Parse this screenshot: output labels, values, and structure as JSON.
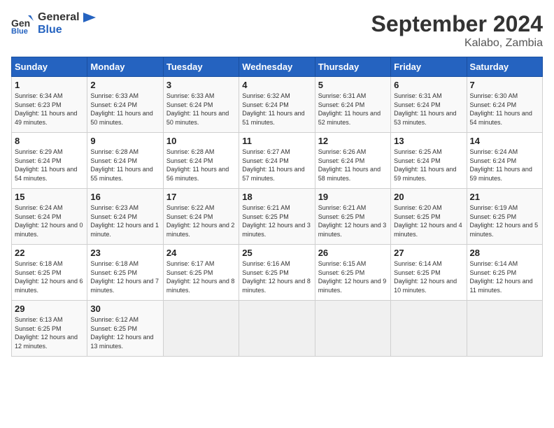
{
  "logo": {
    "line1": "General",
    "line2": "Blue"
  },
  "title": "September 2024",
  "subtitle": "Kalabo, Zambia",
  "days_header": [
    "Sunday",
    "Monday",
    "Tuesday",
    "Wednesday",
    "Thursday",
    "Friday",
    "Saturday"
  ],
  "weeks": [
    [
      {
        "day": "1",
        "sunrise": "Sunrise: 6:34 AM",
        "sunset": "Sunset: 6:23 PM",
        "daylight": "Daylight: 11 hours and 49 minutes."
      },
      {
        "day": "2",
        "sunrise": "Sunrise: 6:33 AM",
        "sunset": "Sunset: 6:24 PM",
        "daylight": "Daylight: 11 hours and 50 minutes."
      },
      {
        "day": "3",
        "sunrise": "Sunrise: 6:33 AM",
        "sunset": "Sunset: 6:24 PM",
        "daylight": "Daylight: 11 hours and 50 minutes."
      },
      {
        "day": "4",
        "sunrise": "Sunrise: 6:32 AM",
        "sunset": "Sunset: 6:24 PM",
        "daylight": "Daylight: 11 hours and 51 minutes."
      },
      {
        "day": "5",
        "sunrise": "Sunrise: 6:31 AM",
        "sunset": "Sunset: 6:24 PM",
        "daylight": "Daylight: 11 hours and 52 minutes."
      },
      {
        "day": "6",
        "sunrise": "Sunrise: 6:31 AM",
        "sunset": "Sunset: 6:24 PM",
        "daylight": "Daylight: 11 hours and 53 minutes."
      },
      {
        "day": "7",
        "sunrise": "Sunrise: 6:30 AM",
        "sunset": "Sunset: 6:24 PM",
        "daylight": "Daylight: 11 hours and 54 minutes."
      }
    ],
    [
      {
        "day": "8",
        "sunrise": "Sunrise: 6:29 AM",
        "sunset": "Sunset: 6:24 PM",
        "daylight": "Daylight: 11 hours and 54 minutes."
      },
      {
        "day": "9",
        "sunrise": "Sunrise: 6:28 AM",
        "sunset": "Sunset: 6:24 PM",
        "daylight": "Daylight: 11 hours and 55 minutes."
      },
      {
        "day": "10",
        "sunrise": "Sunrise: 6:28 AM",
        "sunset": "Sunset: 6:24 PM",
        "daylight": "Daylight: 11 hours and 56 minutes."
      },
      {
        "day": "11",
        "sunrise": "Sunrise: 6:27 AM",
        "sunset": "Sunset: 6:24 PM",
        "daylight": "Daylight: 11 hours and 57 minutes."
      },
      {
        "day": "12",
        "sunrise": "Sunrise: 6:26 AM",
        "sunset": "Sunset: 6:24 PM",
        "daylight": "Daylight: 11 hours and 58 minutes."
      },
      {
        "day": "13",
        "sunrise": "Sunrise: 6:25 AM",
        "sunset": "Sunset: 6:24 PM",
        "daylight": "Daylight: 11 hours and 59 minutes."
      },
      {
        "day": "14",
        "sunrise": "Sunrise: 6:24 AM",
        "sunset": "Sunset: 6:24 PM",
        "daylight": "Daylight: 11 hours and 59 minutes."
      }
    ],
    [
      {
        "day": "15",
        "sunrise": "Sunrise: 6:24 AM",
        "sunset": "Sunset: 6:24 PM",
        "daylight": "Daylight: 12 hours and 0 minutes."
      },
      {
        "day": "16",
        "sunrise": "Sunrise: 6:23 AM",
        "sunset": "Sunset: 6:24 PM",
        "daylight": "Daylight: 12 hours and 1 minute."
      },
      {
        "day": "17",
        "sunrise": "Sunrise: 6:22 AM",
        "sunset": "Sunset: 6:24 PM",
        "daylight": "Daylight: 12 hours and 2 minutes."
      },
      {
        "day": "18",
        "sunrise": "Sunrise: 6:21 AM",
        "sunset": "Sunset: 6:25 PM",
        "daylight": "Daylight: 12 hours and 3 minutes."
      },
      {
        "day": "19",
        "sunrise": "Sunrise: 6:21 AM",
        "sunset": "Sunset: 6:25 PM",
        "daylight": "Daylight: 12 hours and 3 minutes."
      },
      {
        "day": "20",
        "sunrise": "Sunrise: 6:20 AM",
        "sunset": "Sunset: 6:25 PM",
        "daylight": "Daylight: 12 hours and 4 minutes."
      },
      {
        "day": "21",
        "sunrise": "Sunrise: 6:19 AM",
        "sunset": "Sunset: 6:25 PM",
        "daylight": "Daylight: 12 hours and 5 minutes."
      }
    ],
    [
      {
        "day": "22",
        "sunrise": "Sunrise: 6:18 AM",
        "sunset": "Sunset: 6:25 PM",
        "daylight": "Daylight: 12 hours and 6 minutes."
      },
      {
        "day": "23",
        "sunrise": "Sunrise: 6:18 AM",
        "sunset": "Sunset: 6:25 PM",
        "daylight": "Daylight: 12 hours and 7 minutes."
      },
      {
        "day": "24",
        "sunrise": "Sunrise: 6:17 AM",
        "sunset": "Sunset: 6:25 PM",
        "daylight": "Daylight: 12 hours and 8 minutes."
      },
      {
        "day": "25",
        "sunrise": "Sunrise: 6:16 AM",
        "sunset": "Sunset: 6:25 PM",
        "daylight": "Daylight: 12 hours and 8 minutes."
      },
      {
        "day": "26",
        "sunrise": "Sunrise: 6:15 AM",
        "sunset": "Sunset: 6:25 PM",
        "daylight": "Daylight: 12 hours and 9 minutes."
      },
      {
        "day": "27",
        "sunrise": "Sunrise: 6:14 AM",
        "sunset": "Sunset: 6:25 PM",
        "daylight": "Daylight: 12 hours and 10 minutes."
      },
      {
        "day": "28",
        "sunrise": "Sunrise: 6:14 AM",
        "sunset": "Sunset: 6:25 PM",
        "daylight": "Daylight: 12 hours and 11 minutes."
      }
    ],
    [
      {
        "day": "29",
        "sunrise": "Sunrise: 6:13 AM",
        "sunset": "Sunset: 6:25 PM",
        "daylight": "Daylight: 12 hours and 12 minutes."
      },
      {
        "day": "30",
        "sunrise": "Sunrise: 6:12 AM",
        "sunset": "Sunset: 6:25 PM",
        "daylight": "Daylight: 12 hours and 13 minutes."
      },
      null,
      null,
      null,
      null,
      null
    ]
  ]
}
